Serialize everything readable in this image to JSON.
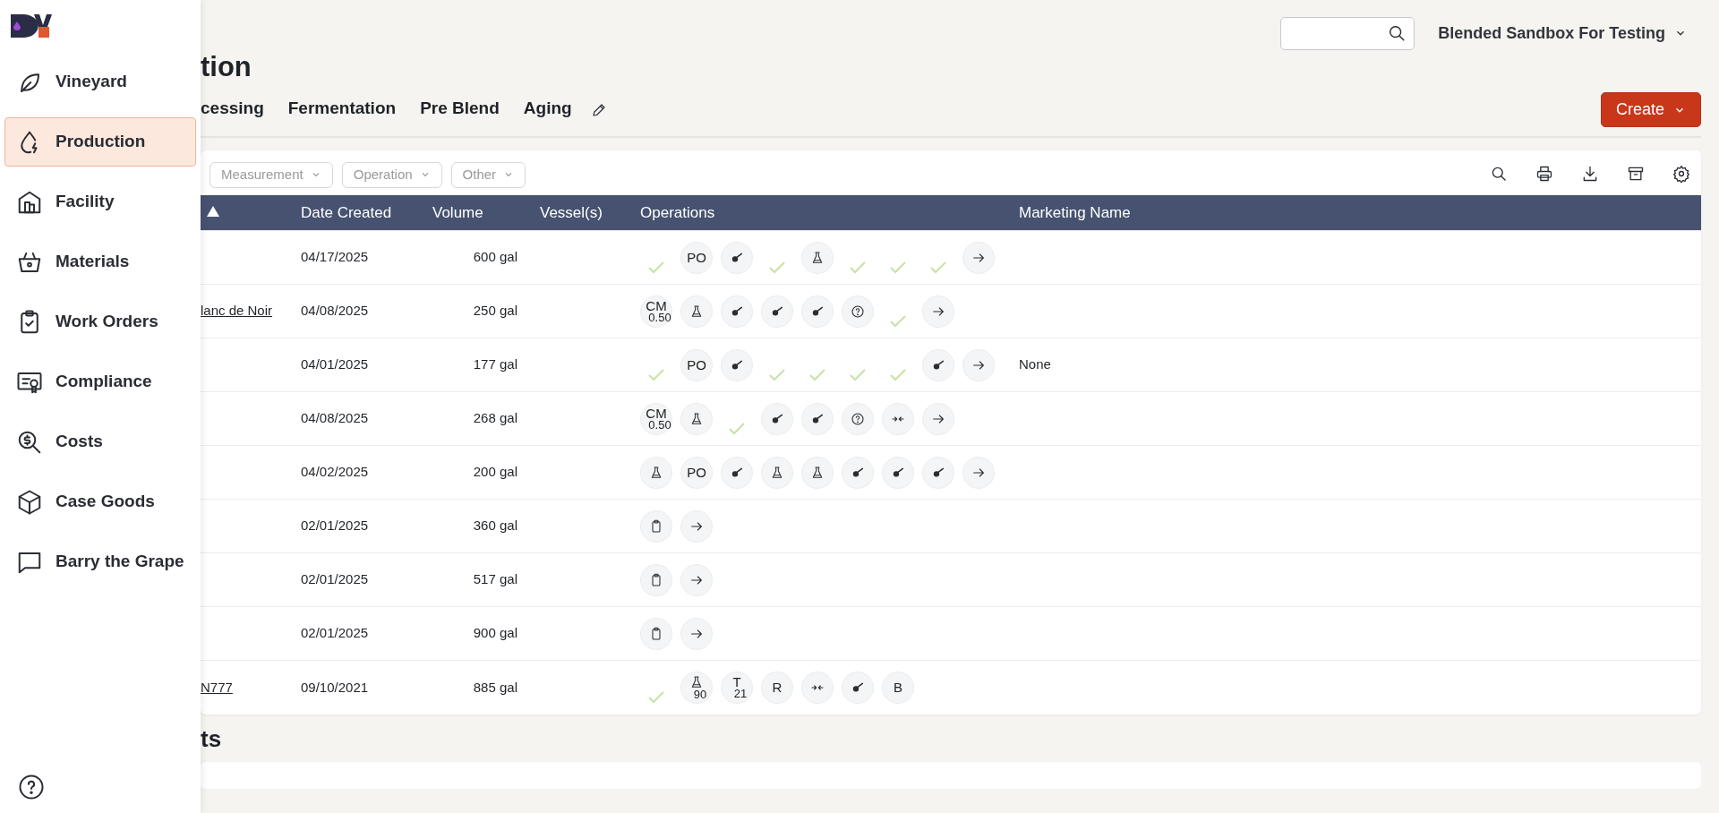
{
  "sidebar": {
    "items": [
      {
        "label": "Vineyard",
        "kind": "leaf",
        "selected": false
      },
      {
        "label": "Production",
        "kind": "drop",
        "selected": true
      },
      {
        "label": "Facility",
        "kind": "building",
        "selected": false
      },
      {
        "label": "Materials",
        "kind": "basket",
        "selected": false
      },
      {
        "label": "Work Orders",
        "kind": "clipboard",
        "selected": false
      },
      {
        "label": "Compliance",
        "kind": "certificate",
        "selected": false
      },
      {
        "label": "Costs",
        "kind": "costs",
        "selected": false
      },
      {
        "label": "Case Goods",
        "kind": "box",
        "selected": false
      },
      {
        "label": "Barry the Grape",
        "kind": "chat",
        "selected": false
      }
    ]
  },
  "workspace": "Blended Sandbox For Testing",
  "page_title": "tion",
  "tabs": [
    {
      "label": "cessing",
      "selected": false
    },
    {
      "label": "Fermentation",
      "selected": false
    },
    {
      "label": "Pre Blend",
      "selected": false
    },
    {
      "label": "Aging",
      "selected": false
    }
  ],
  "create_button": "Create",
  "filters": [
    "Measurement",
    "Operation",
    "Other"
  ],
  "table": {
    "columns": [
      "Date Created",
      "Volume",
      "Vessel(s)",
      "Operations",
      "Marketing Name"
    ],
    "rows": [
      {
        "date": "04/17/2025",
        "volume": "600 gal",
        "operations": [
          {
            "kind": "check"
          },
          {
            "kind": "text",
            "label": "PO"
          },
          {
            "kind": "ladle"
          },
          {
            "kind": "check"
          },
          {
            "kind": "flask"
          },
          {
            "kind": "check"
          },
          {
            "kind": "check"
          },
          {
            "kind": "check"
          },
          {
            "kind": "arrow"
          }
        ]
      },
      {
        "name": "lanc de Noir",
        "date": "04/08/2025",
        "volume": "250 gal",
        "operations": [
          {
            "kind": "text",
            "label": "CM",
            "sub": "0.50"
          },
          {
            "kind": "flask"
          },
          {
            "kind": "ladle"
          },
          {
            "kind": "ladle"
          },
          {
            "kind": "ladle"
          },
          {
            "kind": "help"
          },
          {
            "kind": "check"
          },
          {
            "kind": "arrow"
          }
        ]
      },
      {
        "date": "04/01/2025",
        "volume": "177 gal",
        "marketing_name": "None",
        "operations": [
          {
            "kind": "check"
          },
          {
            "kind": "text",
            "label": "PO"
          },
          {
            "kind": "ladle"
          },
          {
            "kind": "check"
          },
          {
            "kind": "check"
          },
          {
            "kind": "check"
          },
          {
            "kind": "check"
          },
          {
            "kind": "ladle"
          },
          {
            "kind": "arrow"
          }
        ]
      },
      {
        "date": "04/08/2025",
        "volume": "268 gal",
        "operations": [
          {
            "kind": "text",
            "label": "CM",
            "sub": "0.50"
          },
          {
            "kind": "flask"
          },
          {
            "kind": "check"
          },
          {
            "kind": "ladle"
          },
          {
            "kind": "ladle"
          },
          {
            "kind": "help"
          },
          {
            "kind": "transfer"
          },
          {
            "kind": "arrow"
          }
        ]
      },
      {
        "date": "04/02/2025",
        "volume": "200 gal",
        "operations": [
          {
            "kind": "flask"
          },
          {
            "kind": "text",
            "label": "PO"
          },
          {
            "kind": "ladle"
          },
          {
            "kind": "flask"
          },
          {
            "kind": "flask"
          },
          {
            "kind": "ladle"
          },
          {
            "kind": "ladle"
          },
          {
            "kind": "ladle"
          },
          {
            "kind": "arrow"
          }
        ]
      },
      {
        "date": "02/01/2025",
        "volume": "360 gal",
        "operations": [
          {
            "kind": "clipboard"
          },
          {
            "kind": "arrow"
          }
        ]
      },
      {
        "date": "02/01/2025",
        "volume": "517 gal",
        "operations": [
          {
            "kind": "clipboard"
          },
          {
            "kind": "arrow"
          }
        ]
      },
      {
        "date": "02/01/2025",
        "volume": "900 gal",
        "operations": [
          {
            "kind": "clipboard"
          },
          {
            "kind": "arrow"
          }
        ]
      },
      {
        "name": "N777",
        "date": "09/10/2021",
        "volume": "885 gal",
        "operations": [
          {
            "kind": "check"
          },
          {
            "kind": "flask",
            "sub": "90"
          },
          {
            "kind": "text",
            "label": "T",
            "sub": "21"
          },
          {
            "kind": "text",
            "label": "R"
          },
          {
            "kind": "transfer"
          },
          {
            "kind": "ladle"
          },
          {
            "kind": "text",
            "label": "B"
          }
        ]
      }
    ]
  },
  "section_title": "ts"
}
